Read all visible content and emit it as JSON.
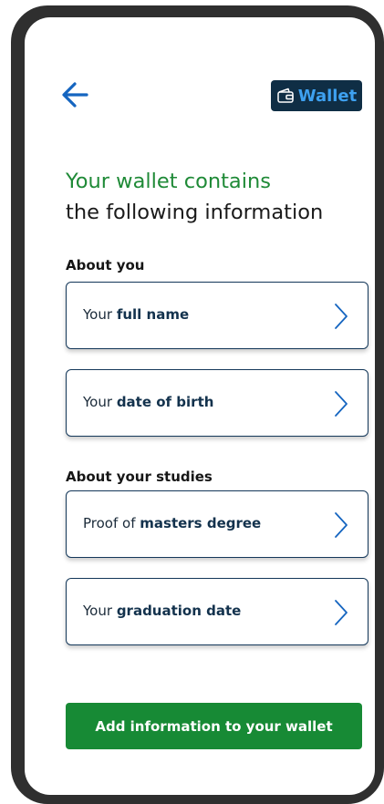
{
  "header": {
    "back_icon": "arrow-left-icon",
    "wallet_icon": "wallet-icon",
    "wallet_label": "Wallet"
  },
  "title": {
    "line1": "Your wallet contains",
    "line2": "the following information"
  },
  "sections": [
    {
      "label": "About you",
      "items": [
        {
          "prefix": "Your",
          "bold": "full name"
        },
        {
          "prefix": "Your",
          "bold": "date of birth"
        }
      ]
    },
    {
      "label": "About your studies",
      "items": [
        {
          "prefix": "Proof of",
          "bold": "masters degree"
        },
        {
          "prefix": "Your",
          "bold": "graduation date"
        }
      ]
    }
  ],
  "cta_label": "Add information to your wallet",
  "colors": {
    "accent_green": "#178a35",
    "title_green": "#1f8a37",
    "navy": "#0f2e45",
    "wallet_text": "#3ea1f0",
    "arrow_blue": "#1565c0"
  }
}
